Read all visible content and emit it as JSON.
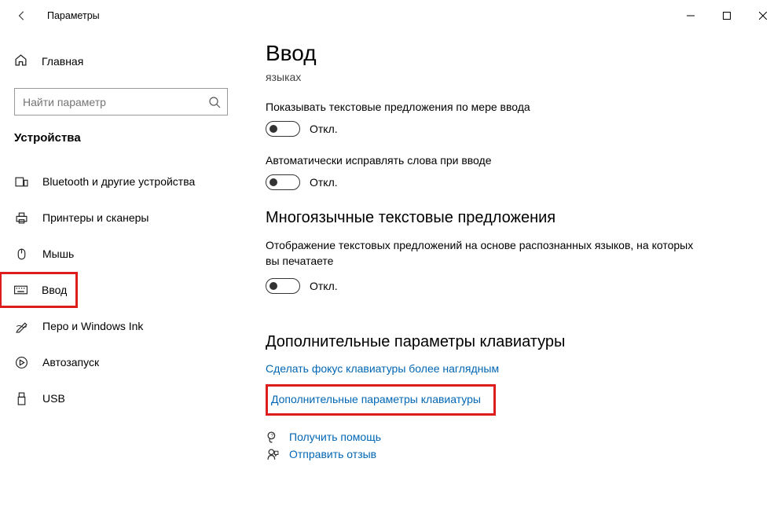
{
  "titlebar": {
    "title": "Параметры"
  },
  "sidebar": {
    "home": "Главная",
    "search_placeholder": "Найти параметр",
    "category": "Устройства",
    "items": [
      {
        "id": "bluetooth",
        "label": "Bluetooth и другие устройства"
      },
      {
        "id": "printers",
        "label": "Принтеры и сканеры"
      },
      {
        "id": "mouse",
        "label": "Мышь"
      },
      {
        "id": "typing",
        "label": "Ввод",
        "active": true,
        "highlighted": true
      },
      {
        "id": "pen",
        "label": "Перо и Windows Ink"
      },
      {
        "id": "autoplay",
        "label": "Автозапуск"
      },
      {
        "id": "usb",
        "label": "USB"
      }
    ]
  },
  "main": {
    "title": "Ввод",
    "residual": "языках",
    "toggles": [
      {
        "label": "Показывать текстовые предложения по мере ввода",
        "state": "Откл."
      },
      {
        "label": "Автоматически исправлять слова при вводе",
        "state": "Откл."
      }
    ],
    "section2_title": "Многоязычные текстовые предложения",
    "section2_desc": "Отображение текстовых предложений на основе распознанных языков, на которых вы печатаете",
    "section2_state": "Откл.",
    "section3_title": "Дополнительные параметры клавиатуры",
    "link_focus": "Сделать фокус клавиатуры более наглядным",
    "link_advanced": "Дополнительные параметры клавиатуры",
    "help": "Получить помощь",
    "feedback": "Отправить отзыв"
  }
}
